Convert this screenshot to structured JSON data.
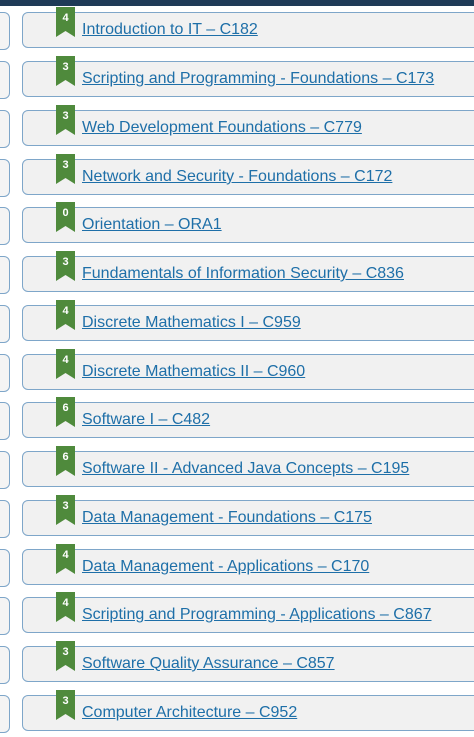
{
  "colors": {
    "accent": "#1e6fa8",
    "badge": "#4f8a3c",
    "card_border": "#7ea6c9",
    "top_bar": "#1f3b57"
  },
  "courses": [
    {
      "units": "4",
      "title": "Introduction to IT – C182"
    },
    {
      "units": "3",
      "title": "Scripting and Programming - Foundations – C173"
    },
    {
      "units": "3",
      "title": "Web Development Foundations – C779"
    },
    {
      "units": "3",
      "title": "Network and Security - Foundations – C172"
    },
    {
      "units": "0",
      "title": "Orientation – ORA1"
    },
    {
      "units": "3",
      "title": "Fundamentals of Information Security – C836"
    },
    {
      "units": "4",
      "title": "Discrete Mathematics I – C959"
    },
    {
      "units": "4",
      "title": "Discrete Mathematics II – C960"
    },
    {
      "units": "6",
      "title": "Software I – C482"
    },
    {
      "units": "6",
      "title": "Software II - Advanced Java Concepts – C195"
    },
    {
      "units": "3",
      "title": "Data Management - Foundations – C175"
    },
    {
      "units": "4",
      "title": "Data Management - Applications – C170"
    },
    {
      "units": "4",
      "title": "Scripting and Programming - Applications – C867"
    },
    {
      "units": "3",
      "title": "Software Quality Assurance – C857"
    },
    {
      "units": "3",
      "title": "Computer Architecture – C952"
    }
  ]
}
